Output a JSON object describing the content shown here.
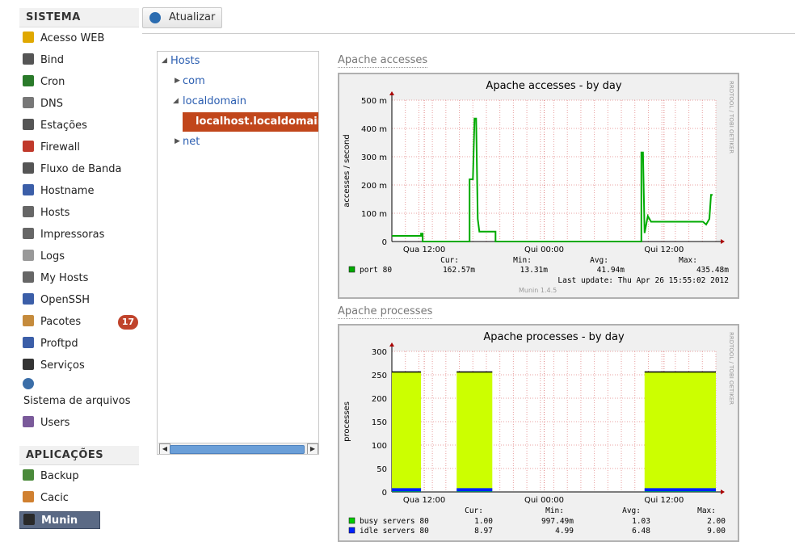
{
  "sidebar": {
    "system_header": "SISTEMA",
    "system_items": [
      {
        "label": "Acesso WEB",
        "icon": "lock-icon"
      },
      {
        "label": "Bind",
        "icon": "document-icon"
      },
      {
        "label": "Cron",
        "icon": "clock-icon"
      },
      {
        "label": "DNS",
        "icon": "book-icon"
      },
      {
        "label": "Estações",
        "icon": "monitor-icon"
      },
      {
        "label": "Firewall",
        "icon": "firewall-icon"
      },
      {
        "label": "Fluxo de Banda",
        "icon": "monitor-icon"
      },
      {
        "label": "Hostname",
        "icon": "computer-icon"
      },
      {
        "label": "Hosts",
        "icon": "network-icon"
      },
      {
        "label": "Impressoras",
        "icon": "printer-icon"
      },
      {
        "label": "Logs",
        "icon": "file-icon"
      },
      {
        "label": "My Hosts",
        "icon": "network-icon"
      },
      {
        "label": "OpenSSH",
        "icon": "computer-icon"
      },
      {
        "label": "Pacotes",
        "icon": "package-icon",
        "badge": "17"
      },
      {
        "label": "Proftpd",
        "icon": "computer-icon"
      },
      {
        "label": "Serviços",
        "icon": "traffic-light-icon"
      },
      {
        "label": "Sistema de arquivos",
        "icon": "disk-icon"
      },
      {
        "label": "Users",
        "icon": "users-icon"
      }
    ],
    "apps_header": "APLICAÇÕES",
    "app_items": [
      {
        "label": "Backup",
        "icon": "backup-icon"
      },
      {
        "label": "Cacic",
        "icon": "cacic-icon"
      },
      {
        "label": "Munin",
        "icon": "munin-icon",
        "active": true
      }
    ]
  },
  "toolbar": {
    "refresh_label": "Atualizar"
  },
  "tree": {
    "root": "Hosts",
    "nodes": [
      "com",
      "localdomain",
      "localhost.localdomain",
      "net"
    ],
    "selected": "localhost.localdomain"
  },
  "graphs": [
    {
      "section_title": "Apache accesses",
      "chart_data": {
        "type": "line",
        "title": "Apache accesses - by day",
        "ylabel": "accesses / second",
        "side_label": "RRDTOOL / TOBI OETIKER",
        "y_ticks": [
          "500 m",
          "400 m",
          "300 m",
          "200 m",
          "100 m",
          "0"
        ],
        "ylim": [
          0,
          500
        ],
        "x_ticks": [
          "Qua 12:00",
          "Qui 00:00",
          "Qui 12:00"
        ],
        "series": [
          {
            "name": "port 80",
            "color": "#00aa00",
            "points": [
              [
                0.0,
                20
              ],
              [
                0.09,
                20
              ],
              [
                0.09,
                28
              ],
              [
                0.095,
                28
              ],
              [
                0.095,
                0
              ],
              [
                0.24,
                0
              ],
              [
                0.24,
                220
              ],
              [
                0.25,
                220
              ],
              [
                0.255,
                435
              ],
              [
                0.26,
                435
              ],
              [
                0.265,
                80
              ],
              [
                0.27,
                35
              ],
              [
                0.32,
                35
              ],
              [
                0.32,
                0
              ],
              [
                0.77,
                0
              ],
              [
                0.77,
                315
              ],
              [
                0.775,
                315
              ],
              [
                0.78,
                30
              ],
              [
                0.79,
                90
              ],
              [
                0.8,
                70
              ],
              [
                0.96,
                70
              ],
              [
                0.97,
                60
              ],
              [
                0.98,
                80
              ],
              [
                0.985,
                165
              ],
              [
                0.99,
                165
              ]
            ]
          }
        ],
        "legend": {
          "headers": [
            "Cur:",
            "Min:",
            "Avg:",
            "Max:"
          ],
          "rows": [
            {
              "name": "port 80",
              "color": "#00aa00",
              "cur": "162.57m",
              "min": "13.31m",
              "avg": "41.94m",
              "max": "435.48m"
            }
          ]
        },
        "last_update": "Last update:  Thu Apr 26 15:55:02 2012",
        "footer": "Munin 1.4.5"
      }
    },
    {
      "section_title": "Apache processes",
      "chart_data": {
        "type": "area",
        "title": "Apache processes - by day",
        "ylabel": "processes",
        "side_label": "RRDTOOL / TOBI OETIKER",
        "y_ticks": [
          "300",
          "250",
          "200",
          "150",
          "100",
          "50",
          "0"
        ],
        "ylim": [
          0,
          300
        ],
        "x_ticks": [
          "Qua 12:00",
          "Qui 00:00",
          "Qui 12:00"
        ],
        "blocks": [
          [
            0.0,
            0.09
          ],
          [
            0.2,
            0.31
          ],
          [
            0.78,
            1.0
          ]
        ],
        "series": [
          {
            "name": "busy servers 80",
            "color": "#00cc00",
            "cur": "1.00",
            "min": "997.49m",
            "avg": "1.03",
            "max": "2.00"
          },
          {
            "name": "idle servers 80",
            "color": "#0022ff",
            "cur": "8.97",
            "min": "4.99",
            "avg": "6.48",
            "max": "9.00"
          }
        ],
        "legend": {
          "headers": [
            "Cur:",
            "Min:",
            "Avg:",
            "Max:"
          ]
        }
      }
    }
  ]
}
